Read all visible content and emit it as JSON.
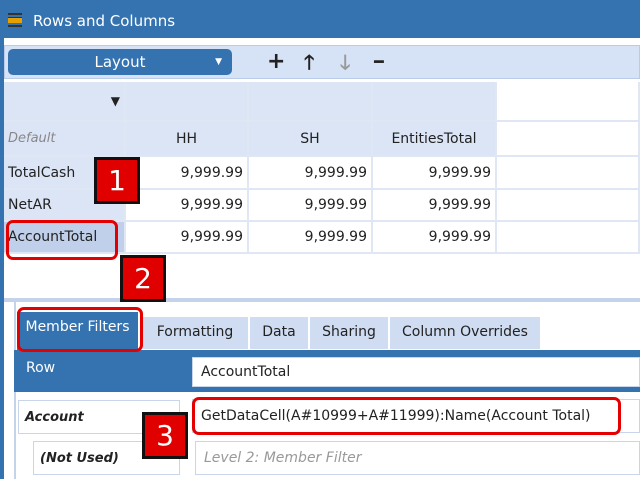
{
  "window": {
    "title": "Rows and Columns"
  },
  "toolbar": {
    "layout_label": "Layout",
    "add": "+",
    "up": "🡑",
    "down": "🡓",
    "remove": "━"
  },
  "grid": {
    "corner": "Default",
    "columns": [
      "HH",
      "SH",
      "EntitiesTotal"
    ],
    "rows": [
      {
        "label": "TotalCash",
        "values": [
          "9,999.99",
          "9,999.99",
          "9,999.99"
        ]
      },
      {
        "label": "NetAR",
        "values": [
          "9,999.99",
          "9,999.99",
          "9,999.99"
        ]
      },
      {
        "label": "AccountTotal",
        "values": [
          "9,999.99",
          "9,999.99",
          "9,999.99"
        ]
      }
    ]
  },
  "tabs": [
    "Member Filters",
    "Formatting",
    "Data",
    "Sharing",
    "Column Overrides"
  ],
  "filters": {
    "row_label": "Row",
    "row_value": "AccountTotal",
    "account_label": "Account",
    "account_value": "GetDataCell(A#10999+A#11999):Name(Account Total)",
    "notused_label": "(Not Used)",
    "notused_placeholder": "Level 2: Member Filter"
  },
  "callouts": [
    "1",
    "2",
    "3"
  ],
  "colors": {
    "accent": "#3473b0",
    "callout": "#e00000",
    "header": "#dbe5f6"
  }
}
